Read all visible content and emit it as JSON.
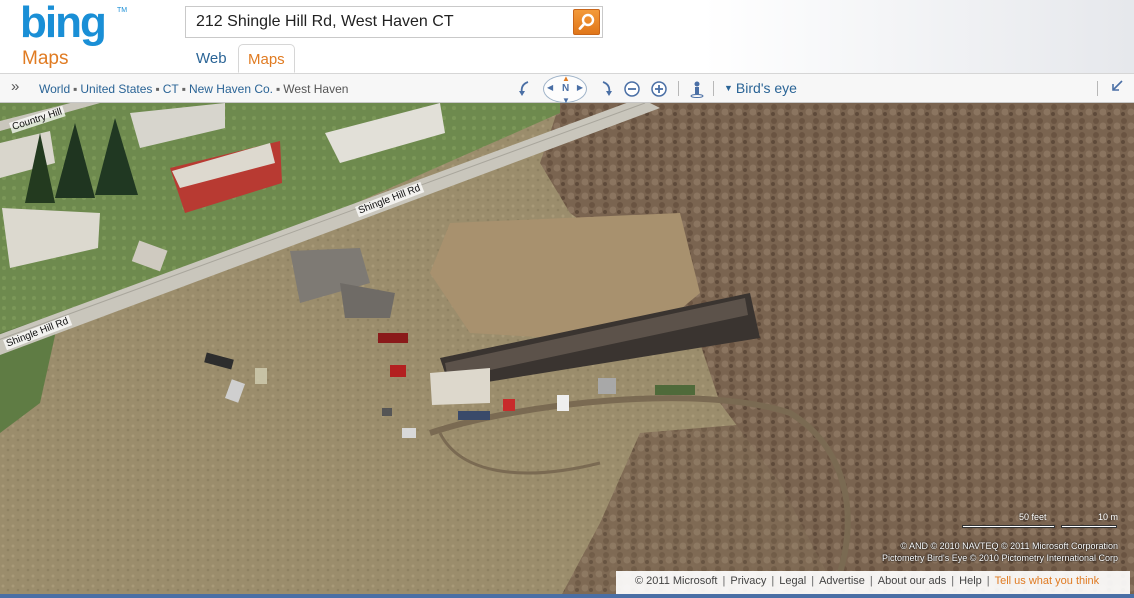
{
  "header": {
    "logo": "bing",
    "logo_tm": "TM",
    "vertical": "Maps",
    "search": {
      "value": "212 Shingle Hill Rd, West Haven CT",
      "button_icon": "search-icon"
    },
    "tabs": [
      {
        "label": "Web"
      },
      {
        "label": "Maps"
      }
    ]
  },
  "toolbar": {
    "breadcrumb": [
      "World",
      "United States",
      "CT",
      "New Haven Co.",
      "West Haven"
    ],
    "compass_label": "N",
    "view_mode": "Bird's eye"
  },
  "map": {
    "road_labels": [
      "Country Hill",
      "Shingle Hill Rd",
      "Shingle Hill Rd"
    ],
    "scale": {
      "feet": "50 feet",
      "meters": "10 m"
    },
    "attribution": [
      "© AND   © 2010 NAVTEQ   © 2011 Microsoft Corporation",
      "Pictometry Bird's Eye © 2010 Pictometry International Corp"
    ]
  },
  "footer": {
    "copyright": "© 2011 Microsoft",
    "links": [
      "Privacy",
      "Legal",
      "Advertise",
      "About our ads",
      "Help"
    ],
    "feedback": "Tell us what you think"
  },
  "colors": {
    "bing_blue": "#1a8fd6",
    "accent_orange": "#e07b22",
    "link_blue": "#2a6496"
  }
}
